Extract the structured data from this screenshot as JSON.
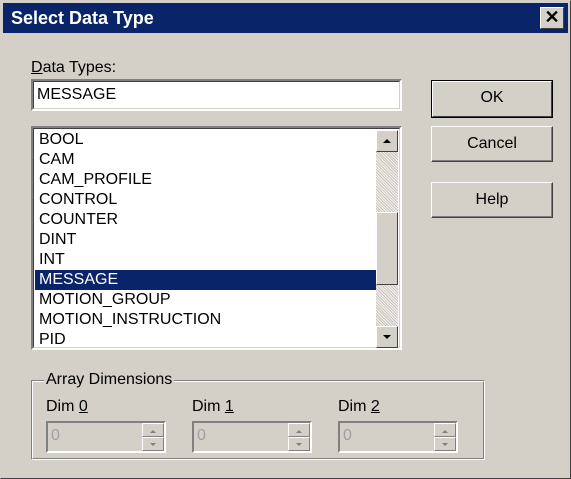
{
  "window": {
    "title": "Select Data Type",
    "close_glyph": "✕"
  },
  "data_types": {
    "label_pre": "",
    "label_underline": "D",
    "label_post": "ata Types:",
    "value": "MESSAGE"
  },
  "buttons": {
    "ok": "OK",
    "cancel": "Cancel",
    "help": "Help"
  },
  "list": {
    "items": [
      "BOOL",
      "CAM",
      "CAM_PROFILE",
      "CONTROL",
      "COUNTER",
      "DINT",
      "INT",
      "MESSAGE",
      "MOTION_GROUP",
      "MOTION_INSTRUCTION",
      "PID"
    ],
    "selected": "MESSAGE"
  },
  "array_dimensions": {
    "title": "Array Dimensions",
    "dims": [
      {
        "label_pre": "Dim ",
        "label_underline": "0",
        "value": "0"
      },
      {
        "label_pre": "Dim ",
        "label_underline": "1",
        "value": "0"
      },
      {
        "label_pre": "Dim ",
        "label_underline": "2",
        "value": "0"
      }
    ]
  },
  "colors": {
    "title_bar": "#0a246a",
    "selection": "#0a246a",
    "face": "#d4d0c8"
  },
  "icons": [
    "close-icon",
    "scroll-up-icon",
    "scroll-down-icon",
    "spin-up-icon",
    "spin-down-icon"
  ]
}
